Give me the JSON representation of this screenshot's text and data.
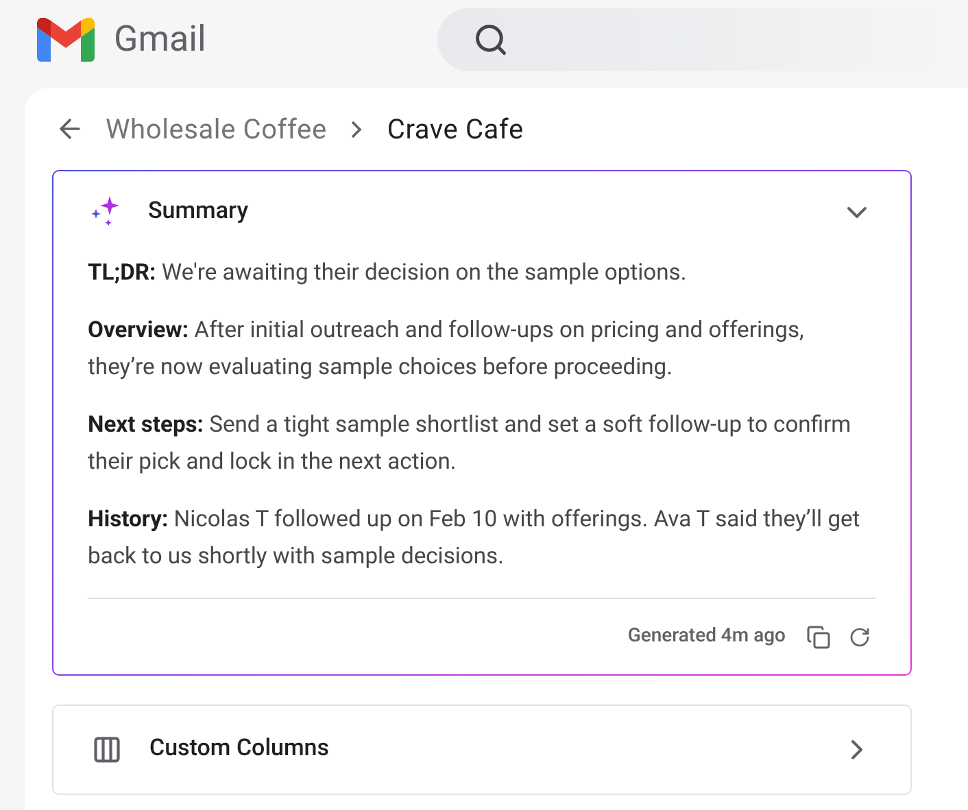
{
  "app": {
    "name": "Gmail"
  },
  "breadcrumb": [
    {
      "label": "Wholesale Coffee",
      "current": false
    },
    {
      "label": "Crave Cafe",
      "current": true
    }
  ],
  "summary": {
    "title": "Summary",
    "expanded": true,
    "sections": [
      {
        "label": "TL;DR:",
        "text": "We're awaiting their decision on the sample options."
      },
      {
        "label": "Overview:",
        "text": "After initial outreach and follow-ups on pricing and offerings, they’re now evaluating sample choices before proceeding."
      },
      {
        "label": "Next steps:",
        "text": "Send a tight sample shortlist and set a soft follow-up to confirm their pick and lock in the next action."
      },
      {
        "label": "History:",
        "text": "Nicolas T followed up on Feb 10 with offerings. Ava T said they’ll get back to us shortly with sample decisions."
      }
    ],
    "footer": "Generated 4m ago"
  },
  "panels": [
    {
      "title": "Custom Columns"
    }
  ]
}
